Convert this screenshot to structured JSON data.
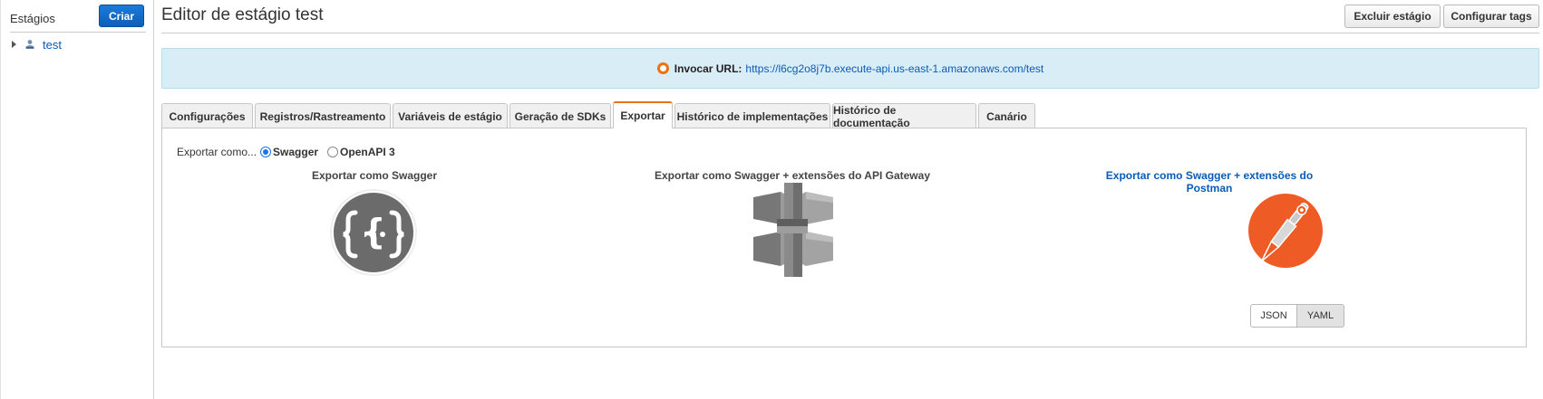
{
  "sidebar": {
    "title": "Estágios",
    "create_label": "Criar",
    "items": [
      {
        "label": "test",
        "icon": "stage-icon"
      }
    ]
  },
  "header": {
    "title": "Editor de estágio test",
    "delete_label": "Excluir estágio",
    "tags_label": "Configurar tags"
  },
  "banner": {
    "label": "Invocar URL:",
    "url": "https://l6cg2o8j7b.execute-api.us-east-1.amazonaws.com/test"
  },
  "tabs": [
    {
      "label": "Configurações",
      "active": false
    },
    {
      "label": "Registros/Rastreamento",
      "active": false
    },
    {
      "label": "Variáveis de estágio",
      "active": false
    },
    {
      "label": "Geração de SDKs",
      "active": false
    },
    {
      "label": "Exportar",
      "active": true
    },
    {
      "label": "Histórico de implementações",
      "active": false
    },
    {
      "label": "Histórico de documentação",
      "active": false
    },
    {
      "label": "Canário",
      "active": false
    }
  ],
  "export": {
    "prompt": "Exportar como...",
    "option_swagger": "Swagger",
    "option_openapi": "OpenAPI 3",
    "selected": "Swagger",
    "col1_title": "Exportar como Swagger",
    "col2_title": "Exportar como Swagger + extensões do API Gateway",
    "col3_title": "Exportar como Swagger + extensões do Postman",
    "format_json": "JSON",
    "format_yaml": "YAML",
    "format_selected": "YAML"
  },
  "colors": {
    "primary_button": "#0b5fb8",
    "accent": "#ec7211",
    "banner_bg": "#d9edf7",
    "link": "#0a5bb5"
  }
}
